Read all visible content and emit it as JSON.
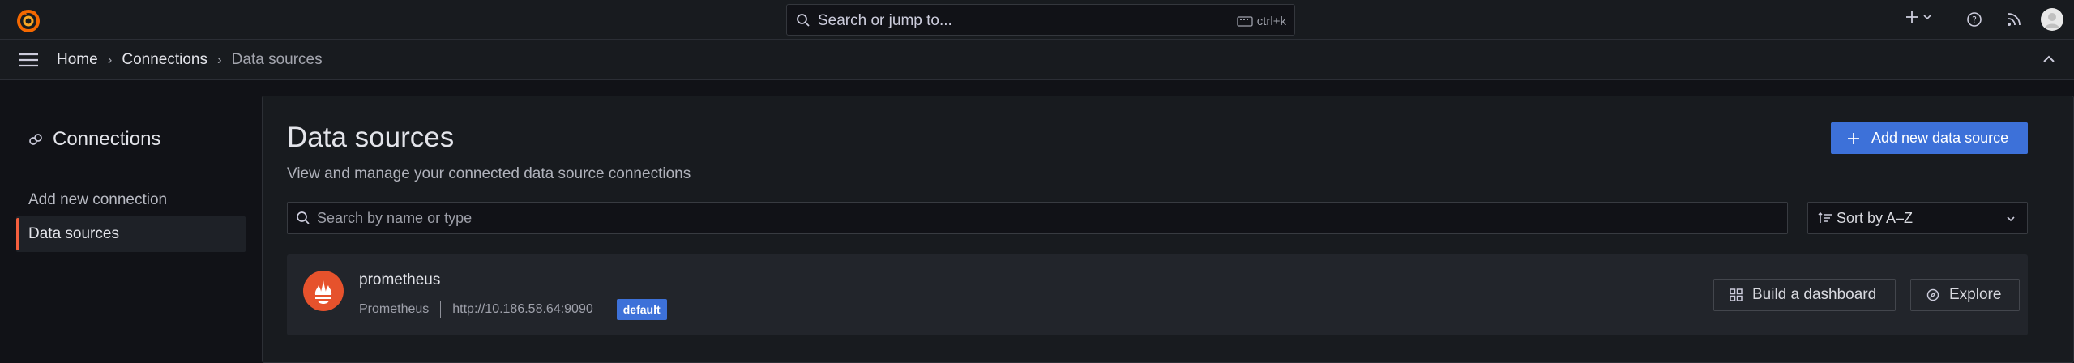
{
  "topbar": {
    "search_placeholder": "Search or jump to...",
    "search_shortcut": "ctrl+k",
    "icons": [
      "grafana-logo-icon",
      "search-icon",
      "keyboard-icon",
      "plus-icon",
      "chevron-down-icon",
      "help-icon",
      "rss-icon",
      "avatar"
    ]
  },
  "breadcrumb": {
    "items": [
      "Home",
      "Connections",
      "Data sources"
    ],
    "separator": "›"
  },
  "sidebar": {
    "title": "Connections",
    "items": [
      {
        "label": "Add new connection",
        "active": false
      },
      {
        "label": "Data sources",
        "active": true
      }
    ]
  },
  "main": {
    "title": "Data sources",
    "subtitle": "View and manage your connected data source connections",
    "add_button_label": "Add new data source",
    "filter_placeholder": "Search by name or type",
    "sort_label": "Sort by A–Z"
  },
  "datasources": [
    {
      "name": "prometheus",
      "type": "Prometheus",
      "url": "http://10.186.58.64:9090",
      "badge": "default",
      "actions": {
        "build": "Build a dashboard",
        "explore": "Explore"
      }
    }
  ],
  "colors": {
    "accent_blue": "#3d71d9",
    "active_orange": "#f55f3e",
    "prometheus_orange": "#e6522c",
    "background": "#111217",
    "panel": "#181b1f"
  }
}
